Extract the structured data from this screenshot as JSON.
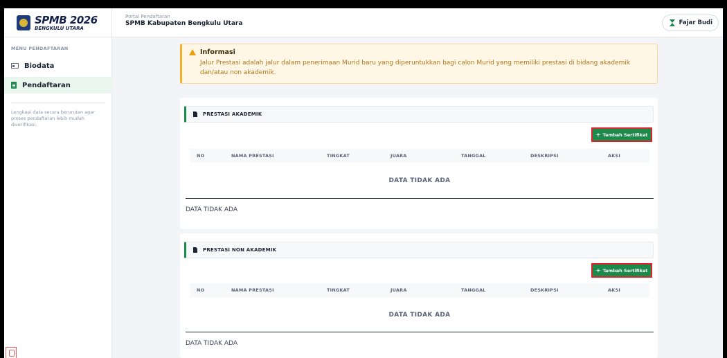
{
  "brand": {
    "title": "SPMB 2026",
    "subtitle": "BENGKULU UTARA"
  },
  "portal": {
    "label": "Portal Pendaftaran",
    "name": "SPMB Kabupaten Bengkulu Utara"
  },
  "user": {
    "name": "Fajar Budi",
    "icon": "hourglass-icon"
  },
  "sidebar": {
    "heading": "MENU PENDAFTARAN",
    "items": [
      {
        "label": "Biodata",
        "icon": "id-card-icon",
        "active": false
      },
      {
        "label": "Pendaftaran",
        "icon": "clipboard-icon",
        "active": true
      }
    ],
    "note": "Lengkapi data secara berurutan agar proses pendaftaran lebih mudah diverifikasi."
  },
  "alert": {
    "title": "Informasi",
    "body": "Jalur Prestasi adalah jalur dalam penerimaan Murid baru yang diperuntukkan bagi calon Murid yang memiliki prestasi di bidang akademik dan/atau non akademik.",
    "color": "#f1b12c"
  },
  "table_columns": [
    "NO",
    "NAMA PRESTASI",
    "TINGKAT",
    "JUARA",
    "TANGGAL",
    "DESKRIPSI",
    "AKSI"
  ],
  "sections": [
    {
      "title": "PRESTASI AKADEMIK",
      "add_label": "Tambah Sertifikat",
      "empty_text": "DATA TIDAK ADA",
      "footer_text": "DATA TIDAK ADA"
    },
    {
      "title": "PRESTASI NON AKADEMIK",
      "add_label": "Tambah Sertifikat",
      "empty_text": "DATA TIDAK ADA",
      "footer_text": "DATA TIDAK ADA"
    }
  ],
  "colors": {
    "accent": "#1c8a4a",
    "highlight": "#e0222a",
    "warning": "#f1b12c"
  }
}
